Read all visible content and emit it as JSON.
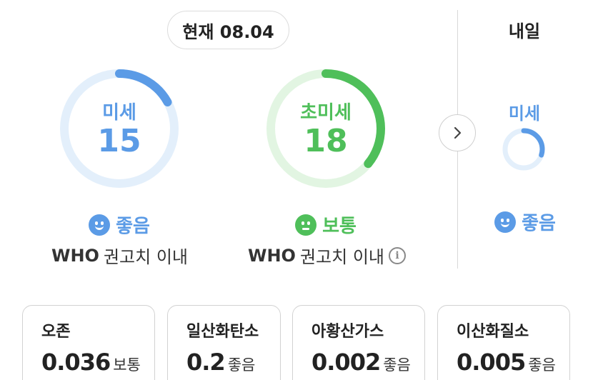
{
  "header": {
    "current_label": "현재 08.04",
    "tomorrow_label": "내일"
  },
  "today": {
    "pm10": {
      "label": "미세",
      "value": "15",
      "progress": 0.17,
      "status": "좋음",
      "note_bold": "WHO",
      "note": "권고치 이내",
      "color": "#5b9be6",
      "track_color": "#e3effb"
    },
    "pm25": {
      "label": "초미세",
      "value": "18",
      "progress": 0.36,
      "status": "보통",
      "note_bold": "WHO",
      "note": "권고치 이내",
      "color": "#4fbf5a",
      "track_color": "#e2f5e2"
    }
  },
  "tomorrow": {
    "pm10": {
      "label": "미세",
      "progress": 0.3,
      "status": "좋음",
      "color": "#5b9be6",
      "track_color": "#e3effb"
    }
  },
  "icons": {
    "next": "chevron-right-icon",
    "info": "info-icon",
    "good": "smile-face-icon",
    "normal": "neutral-face-icon"
  },
  "pollutants": [
    {
      "name": "오존",
      "value": "0.036",
      "grade": "보통"
    },
    {
      "name": "일산화탄소",
      "value": "0.2",
      "grade": "좋음"
    },
    {
      "name": "아황산가스",
      "value": "0.002",
      "grade": "좋음"
    },
    {
      "name": "이산화질소",
      "value": "0.005",
      "grade": "좋음"
    }
  ]
}
